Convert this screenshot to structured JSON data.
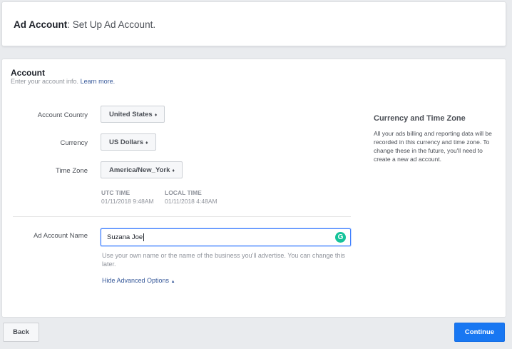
{
  "header": {
    "title_bold": "Ad Account",
    "title_rest": ": Set Up Ad Account."
  },
  "account": {
    "title": "Account",
    "subtitle": "Enter your account info.",
    "learn_more": "Learn more.",
    "country_label": "Account Country",
    "country_value": "United States",
    "currency_label": "Currency",
    "currency_value": "US Dollars",
    "timezone_label": "Time Zone",
    "timezone_value": "America/New_York",
    "utc_head": "UTC TIME",
    "utc_value": "01/11/2018 9:48AM",
    "local_head": "LOCAL TIME",
    "local_value": "01/11/2018 4:48AM",
    "name_label": "Ad Account Name",
    "name_value": "Suzana Joe",
    "name_help": "Use your own name or the name of the business you'll advertise. You can change this later.",
    "advanced_toggle": "Hide Advanced Options"
  },
  "info": {
    "title": "Currency and Time Zone",
    "body": "All your ads billing and reporting data will be recorded in this currency and time zone. To change these in the future, you'll need to create a new ad account."
  },
  "footer": {
    "back_label": "Back",
    "continue_label": "Continue"
  },
  "icons": {
    "select_caret": "♦",
    "grammarly": "G",
    "advanced_caret": "▲"
  },
  "colors": {
    "primary": "#1877f2",
    "link": "#365899",
    "grammarly": "#15c39a"
  }
}
